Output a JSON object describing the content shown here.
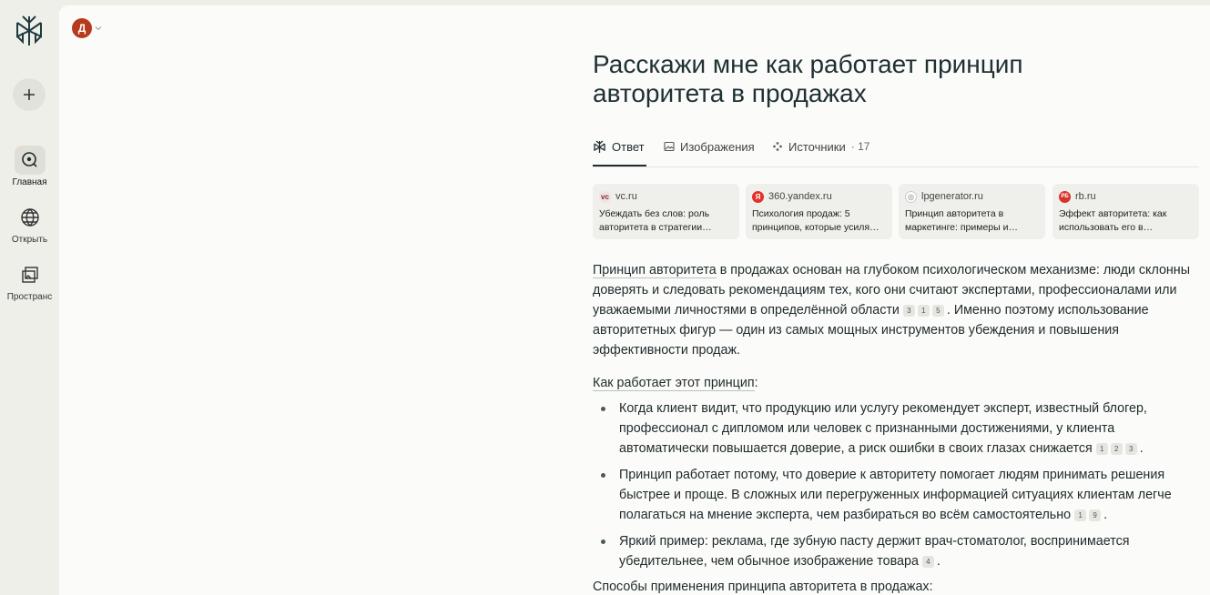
{
  "sidebar": {
    "items": [
      {
        "label": "Главная"
      },
      {
        "label": "Открыть"
      },
      {
        "label": "Пространс"
      }
    ]
  },
  "user": {
    "avatar_letter": "Д"
  },
  "query": "Расскажи мне как работает принцип авторитета в продажах",
  "tabs": {
    "answer": "Ответ",
    "images": "Изображения",
    "sources": "Источники",
    "sources_count": "· 17"
  },
  "sources": [
    {
      "domain": "vc.ru",
      "title": "Убеждать без слов: роль авторитета в стратегии…",
      "favicon": "vc",
      "color": "#7a2d2d"
    },
    {
      "domain": "360.yandex.ru",
      "title": "Психология продаж: 5 принципов, которые усиля…",
      "favicon": "Я",
      "color": "#e3322b"
    },
    {
      "domain": "lpgenerator.ru",
      "title": "Принцип авторитета в маркетинге: примеры и…",
      "favicon": "◎",
      "color": "#b9b9b9"
    },
    {
      "domain": "rb.ru",
      "title": "Эффект авторитета: как использовать его в…",
      "favicon": "РБ",
      "color": "#d8342a"
    }
  ],
  "answer": {
    "p1_link": "Принцип авторитета",
    "p1_a": " в продажах основан на глубоком психологическом механизме: люди склонны доверять и следовать рекомендациям тех, кого они считают экспертами, профессионалами или уважаемыми личностями в определённой области",
    "p1_cites": [
      "3",
      "1",
      "5"
    ],
    "p1_b": ". Именно поэтому использование авторитетных фигур — один из самых мощных инструментов убеждения и повышения эффективности продаж.",
    "p2_link": "Как работает этот принцип",
    "p2_colon": ":",
    "bullets": [
      {
        "text": "Когда клиент видит, что продукцию или услугу рекомендует эксперт, известный блогер, профессионал с дипломом или человек с признанными достижениями, у клиента автоматически повышается доверие, а риск ошибки в своих глазах снижается",
        "cites": [
          "1",
          "2",
          "3"
        ],
        "end": "."
      },
      {
        "text": "Принцип работает потому, что доверие к авторитету помогает людям принимать решения быстрее и проще. В сложных или перегруженных информацией ситуациях клиентам легче полагаться на мнение эксперта, чем разбираться во всём самостоятельно",
        "cites": [
          "1",
          "9"
        ],
        "end": "."
      },
      {
        "text": "Яркий пример: реклама, где зубную пасту держит врач-стоматолог, воспринимается убедительнее, чем обычное изображение товара",
        "cites": [
          "4"
        ],
        "end": "."
      }
    ],
    "p3": "Способы применения принципа авторитета в продажах:"
  }
}
